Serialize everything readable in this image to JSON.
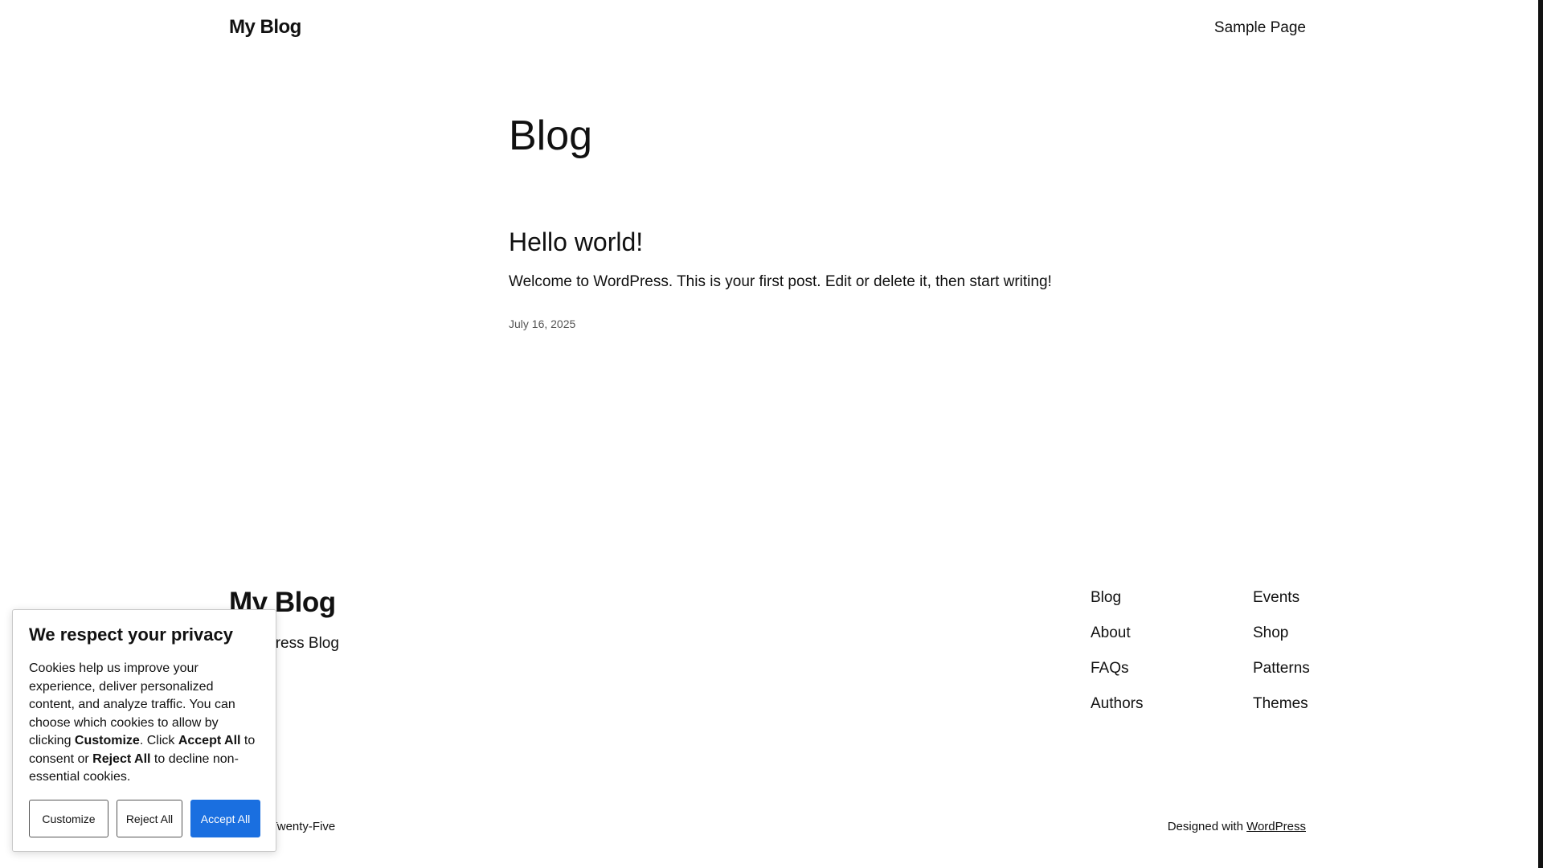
{
  "header": {
    "site_title": "My Blog",
    "nav_items": [
      "Sample Page"
    ]
  },
  "main": {
    "page_heading": "Blog",
    "post": {
      "title": "Hello world!",
      "excerpt": "Welcome to WordPress. This is your first post. Edit or delete it, then start writing!",
      "date": "July 16, 2025"
    }
  },
  "footer": {
    "title": "My Blog",
    "tagline": "WordPress Blog",
    "nav_col1": [
      "Blog",
      "About",
      "FAQs",
      "Authors"
    ],
    "nav_col2": [
      "Events",
      "Shop",
      "Patterns",
      "Themes"
    ],
    "credit_left": "Twenty Twenty-Five",
    "credit_right_prefix": "Designed with",
    "credit_right_link": "WordPress"
  },
  "cookie_banner": {
    "title": "We respect your privacy",
    "text_1": "Cookies help us improve your experience, deliver personalized content, and analyze traffic. You can choose which cookies to allow by clicking ",
    "bold_customize": "Customize",
    "text_2": ". Click ",
    "bold_accept": "Accept All",
    "text_3": " to consent or ",
    "bold_reject": "Reject All",
    "text_4": " to decline non-essential cookies.",
    "buttons": {
      "customize": "Customize",
      "reject": "Reject All",
      "accept": "Accept All"
    },
    "accept_color": "#1a6fe0"
  }
}
